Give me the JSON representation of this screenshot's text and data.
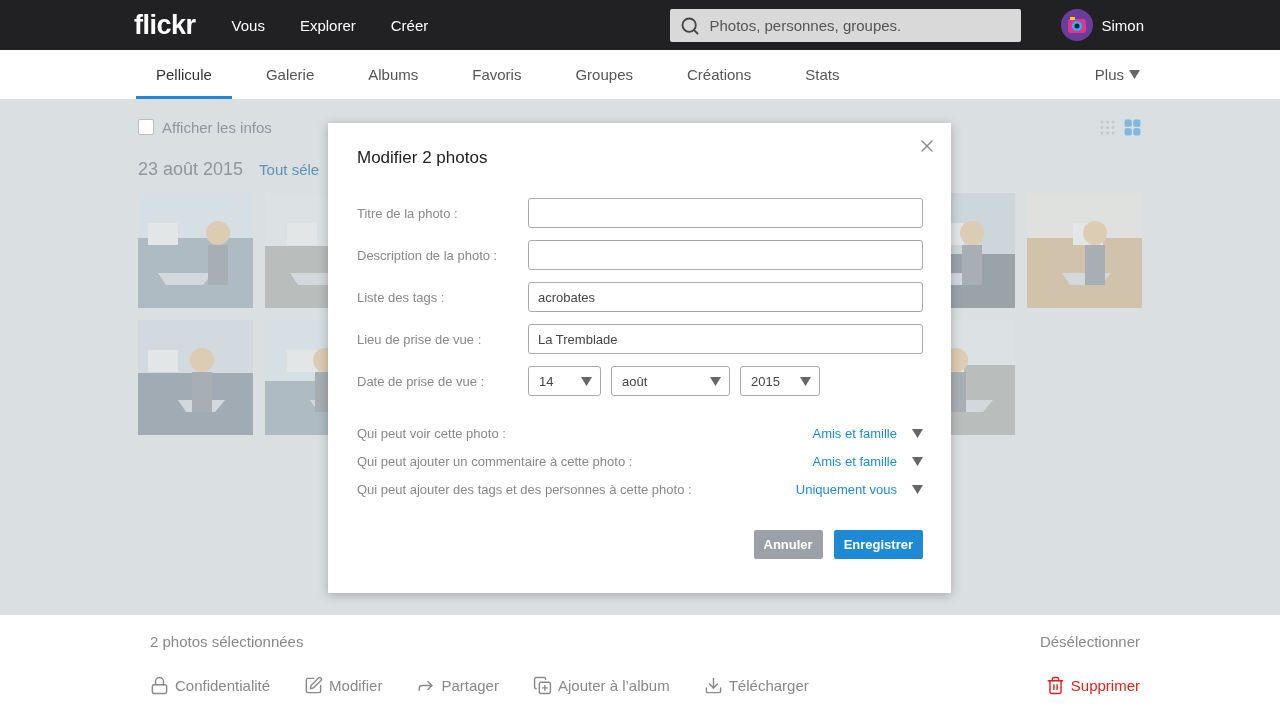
{
  "header": {
    "logo": "flickr",
    "nav": [
      "Vous",
      "Explorer",
      "Créer"
    ],
    "search": {
      "placeholder": "Photos, personnes, groupes."
    },
    "user": {
      "name": "Simon"
    }
  },
  "subnav": {
    "tabs": [
      {
        "label": "Pellicule",
        "selected": true
      },
      {
        "label": "Galerie",
        "selected": false
      },
      {
        "label": "Albums",
        "selected": false
      },
      {
        "label": "Favoris",
        "selected": false
      },
      {
        "label": "Groupes",
        "selected": false
      },
      {
        "label": "Créations",
        "selected": false
      },
      {
        "label": "Stats",
        "selected": false
      }
    ],
    "more": "Plus"
  },
  "toolbar": {
    "show_info": {
      "label": "Afficher les infos",
      "checked": false
    },
    "views": [
      {
        "kind": "small",
        "selected": false
      },
      {
        "kind": "large",
        "selected": true
      }
    ]
  },
  "photostream": {
    "date": "23 août 2015",
    "select_all": "Tout séle",
    "rows": [
      {
        "tiles": [
          {
            "kind": "picture"
          },
          {
            "kind": "left-part"
          },
          {
            "kind": "empty"
          },
          {
            "kind": "empty"
          },
          {
            "kind": "empty"
          },
          {
            "kind": "empty"
          },
          {
            "kind": "right-part"
          },
          {
            "kind": "picture"
          }
        ]
      },
      {
        "tiles": [
          {
            "kind": "picture"
          },
          {
            "kind": "left-part"
          },
          {
            "kind": "empty"
          },
          {
            "kind": "empty"
          },
          {
            "kind": "empty"
          },
          {
            "kind": "empty"
          },
          {
            "kind": "right-part"
          }
        ]
      }
    ]
  },
  "dialog": {
    "title": "Modifier 2 photos",
    "fields": [
      {
        "kind": "text",
        "label": "Titre de la photo :"
      },
      {
        "kind": "text",
        "label": "Description de la photo :"
      },
      {
        "kind": "text",
        "label": "Liste des tags :",
        "value": "acrobates"
      },
      {
        "kind": "text",
        "label": "Lieu de prise de vue :",
        "value": "La Tremblade"
      },
      {
        "kind": "date",
        "label": "Date de prise de vue :",
        "selects": [
          "14",
          "août",
          "2015"
        ]
      }
    ],
    "privacy": [
      {
        "label": "Qui peut voir cette photo :",
        "value": "Amis et famille"
      },
      {
        "label": "Qui peut ajouter un commentaire à cette photo :",
        "value": "Amis et famille"
      },
      {
        "label": "Qui peut ajouter des tags et des personnes à cette photo :",
        "value": "Uniquement vous"
      }
    ],
    "buttons": [
      {
        "label": "Annuler",
        "kind": "secondary"
      },
      {
        "label": "Enregistrer",
        "kind": "primary"
      }
    ]
  },
  "selection_bar": {
    "count": "2 photos sélectionnées",
    "deselect": "Désélectionner",
    "actions": [
      {
        "kind": "privacy",
        "label": "Confidentialité"
      },
      {
        "kind": "edit",
        "label": "Modifier"
      },
      {
        "kind": "share",
        "label": "Partager"
      },
      {
        "kind": "album",
        "label": "Ajouter à l’album"
      },
      {
        "kind": "download",
        "label": "Télécharger"
      },
      {
        "kind": "delete",
        "label": "Supprimer"
      }
    ]
  }
}
